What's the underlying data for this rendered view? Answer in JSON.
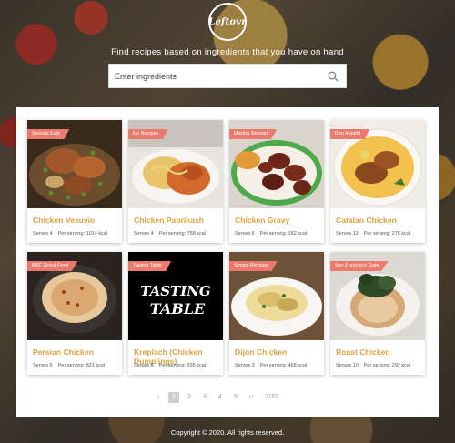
{
  "app": {
    "logo_text": "Leftovr",
    "tagline": "Find recipes based on ingredients that you have on hand"
  },
  "search": {
    "placeholder": "Enter ingredients",
    "value": ""
  },
  "recipes": [
    {
      "source": "Serious Eats",
      "title": "Chicken Vesuvio",
      "serves": "Serves 4",
      "kcal": "Per serving: 1014 kcal",
      "image": "roast-chicken-potatoes-peas"
    },
    {
      "source": "No Recipes",
      "title": "Chicken Paprikash",
      "serves": "Serves 4",
      "kcal": "Per serving: 758 kcal",
      "image": "paprikash-egg-noodles"
    },
    {
      "source": "Martha Stewart",
      "title": "Chicken Gravy",
      "serves": "Serves 6",
      "kcal": "Per serving: 182 kcal",
      "image": "glazed-chicken-wings"
    },
    {
      "source": "Bon Appétit",
      "title": "Catalan Chicken",
      "serves": "Serves 12",
      "kcal": "Per serving: 275 kcal",
      "image": "chicken-legs-plate"
    },
    {
      "source": "BBC Good Food",
      "title": "Persian Chicken",
      "serves": "Serves 5",
      "kcal": "Per serving: 821 kcal",
      "image": "persian-rice-dish"
    },
    {
      "source": "Tasting Table",
      "title": "Kreplach (Chicken Dumplings)",
      "serves": "Serves 8",
      "kcal": "Per serving: 535 kcal",
      "image": "tasting-table-logo"
    },
    {
      "source": "Simply Recipes",
      "title": "Dijon Chicken",
      "serves": "Serves 3",
      "kcal": "Per serving: 468 kcal",
      "image": "dijon-chicken-pasta"
    },
    {
      "source": "San Francisco Gate",
      "title": "Roast Chicken",
      "serves": "Serves 10",
      "kcal": "Per serving: 292 kcal",
      "image": "stuffed-potato-greens"
    }
  ],
  "pagination": {
    "prev": "‹",
    "pages": [
      "1",
      "2",
      "3",
      "4",
      "5"
    ],
    "next": "››",
    "last": "2102",
    "active": "1"
  },
  "footer": {
    "text": "Copyright © 2020. All rights reserved."
  },
  "colors": {
    "accent": "#d9a441",
    "badge": "#e97a6d"
  }
}
